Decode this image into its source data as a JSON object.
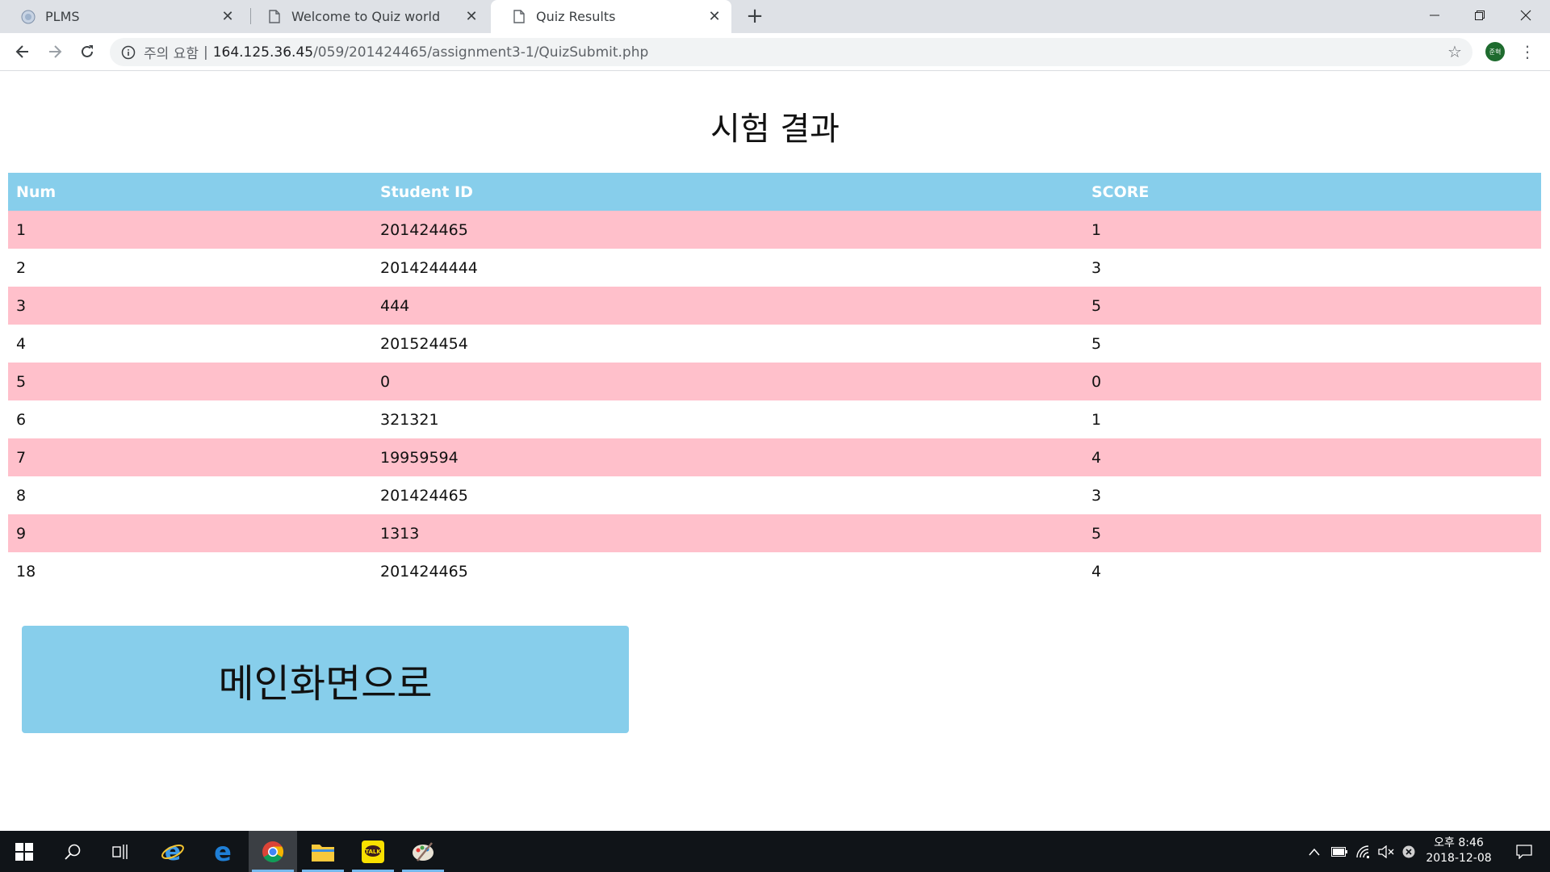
{
  "browser": {
    "tabs": [
      {
        "title": "PLMS",
        "icon": "plms-favicon"
      },
      {
        "title": "Welcome to Quiz world",
        "icon": "document-icon"
      },
      {
        "title": "Quiz Results",
        "icon": "document-icon",
        "active": true
      }
    ],
    "omnibox": {
      "security_label": "주의 요함",
      "separator": "|",
      "host": "164.125.36.45",
      "path": "/059/201424465/assignment3-1/QuizSubmit.php"
    },
    "profile_label": "준혁"
  },
  "page": {
    "title": "시험 결과",
    "table": {
      "headers": [
        "Num",
        "Student ID",
        "SCORE"
      ],
      "rows": [
        [
          "1",
          "201424465",
          "1"
        ],
        [
          "2",
          "2014244444",
          "3"
        ],
        [
          "3",
          "444",
          "5"
        ],
        [
          "4",
          "201524454",
          "5"
        ],
        [
          "5",
          "0",
          "0"
        ],
        [
          "6",
          "321321",
          "1"
        ],
        [
          "7",
          "19959594",
          "4"
        ],
        [
          "8",
          "201424465",
          "3"
        ],
        [
          "9",
          "1313",
          "5"
        ],
        [
          "18",
          "201424465",
          "4"
        ]
      ]
    },
    "main_button_label": "메인화면으로"
  },
  "taskbar": {
    "clock_time": "오후 8:46",
    "clock_date": "2018-12-08"
  },
  "colors": {
    "header_bg": "#87ceeb",
    "odd_row_bg": "#ffc0cb",
    "button_bg": "#87ceeb"
  }
}
